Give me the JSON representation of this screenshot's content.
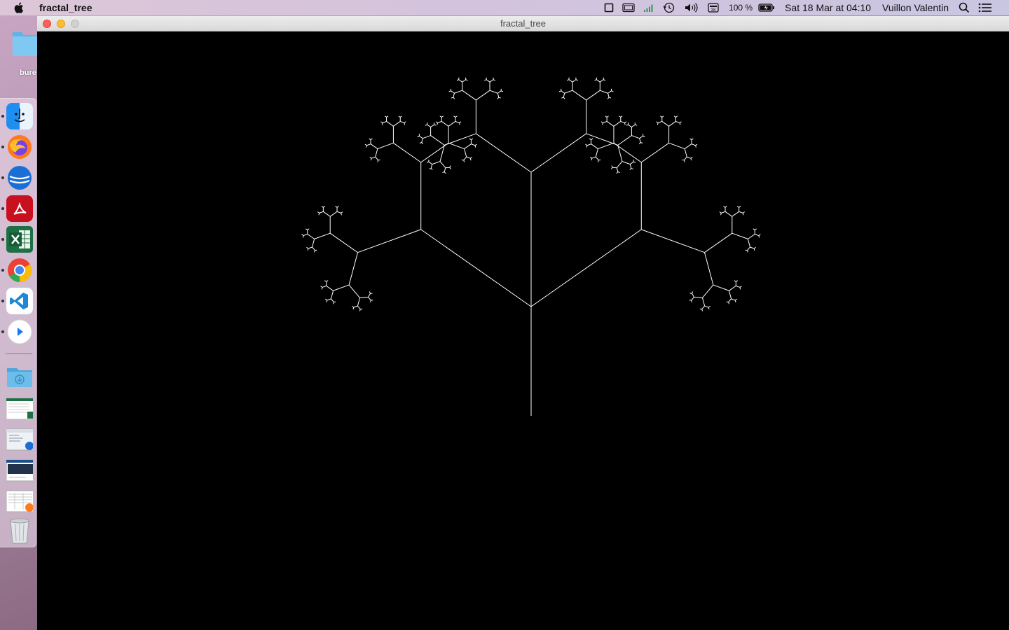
{
  "menubar": {
    "app_name": "fractal_tree",
    "battery_percent": "100 %",
    "datetime": "Sat 18 Mar at  04:10",
    "user": "Vuillon Valentin"
  },
  "desktop": {
    "folder_label": "bure"
  },
  "dock": {
    "apps": [
      {
        "icon": "finder-icon",
        "running": true
      },
      {
        "icon": "firefox-icon",
        "running": true
      },
      {
        "icon": "thunderbird-icon",
        "running": true
      },
      {
        "icon": "acrobat-icon",
        "running": true
      },
      {
        "icon": "excel-icon",
        "running": true
      },
      {
        "icon": "chrome-icon",
        "running": true
      },
      {
        "icon": "vscode-icon",
        "running": true
      },
      {
        "icon": "quicktime-icon",
        "running": true
      }
    ],
    "stack": [
      "downloads-folder-icon",
      "excel-doc-icon",
      "mail-doc-icon",
      "vscode-doc-icon",
      "firefox-doc-icon",
      "trash-icon"
    ]
  },
  "window": {
    "title": "fractal_tree",
    "background": "#000000"
  },
  "fractal": {
    "stroke_color": "#ffffff",
    "depth": 6,
    "length_ratio": 0.5,
    "branch_angle_deg": 55
  }
}
